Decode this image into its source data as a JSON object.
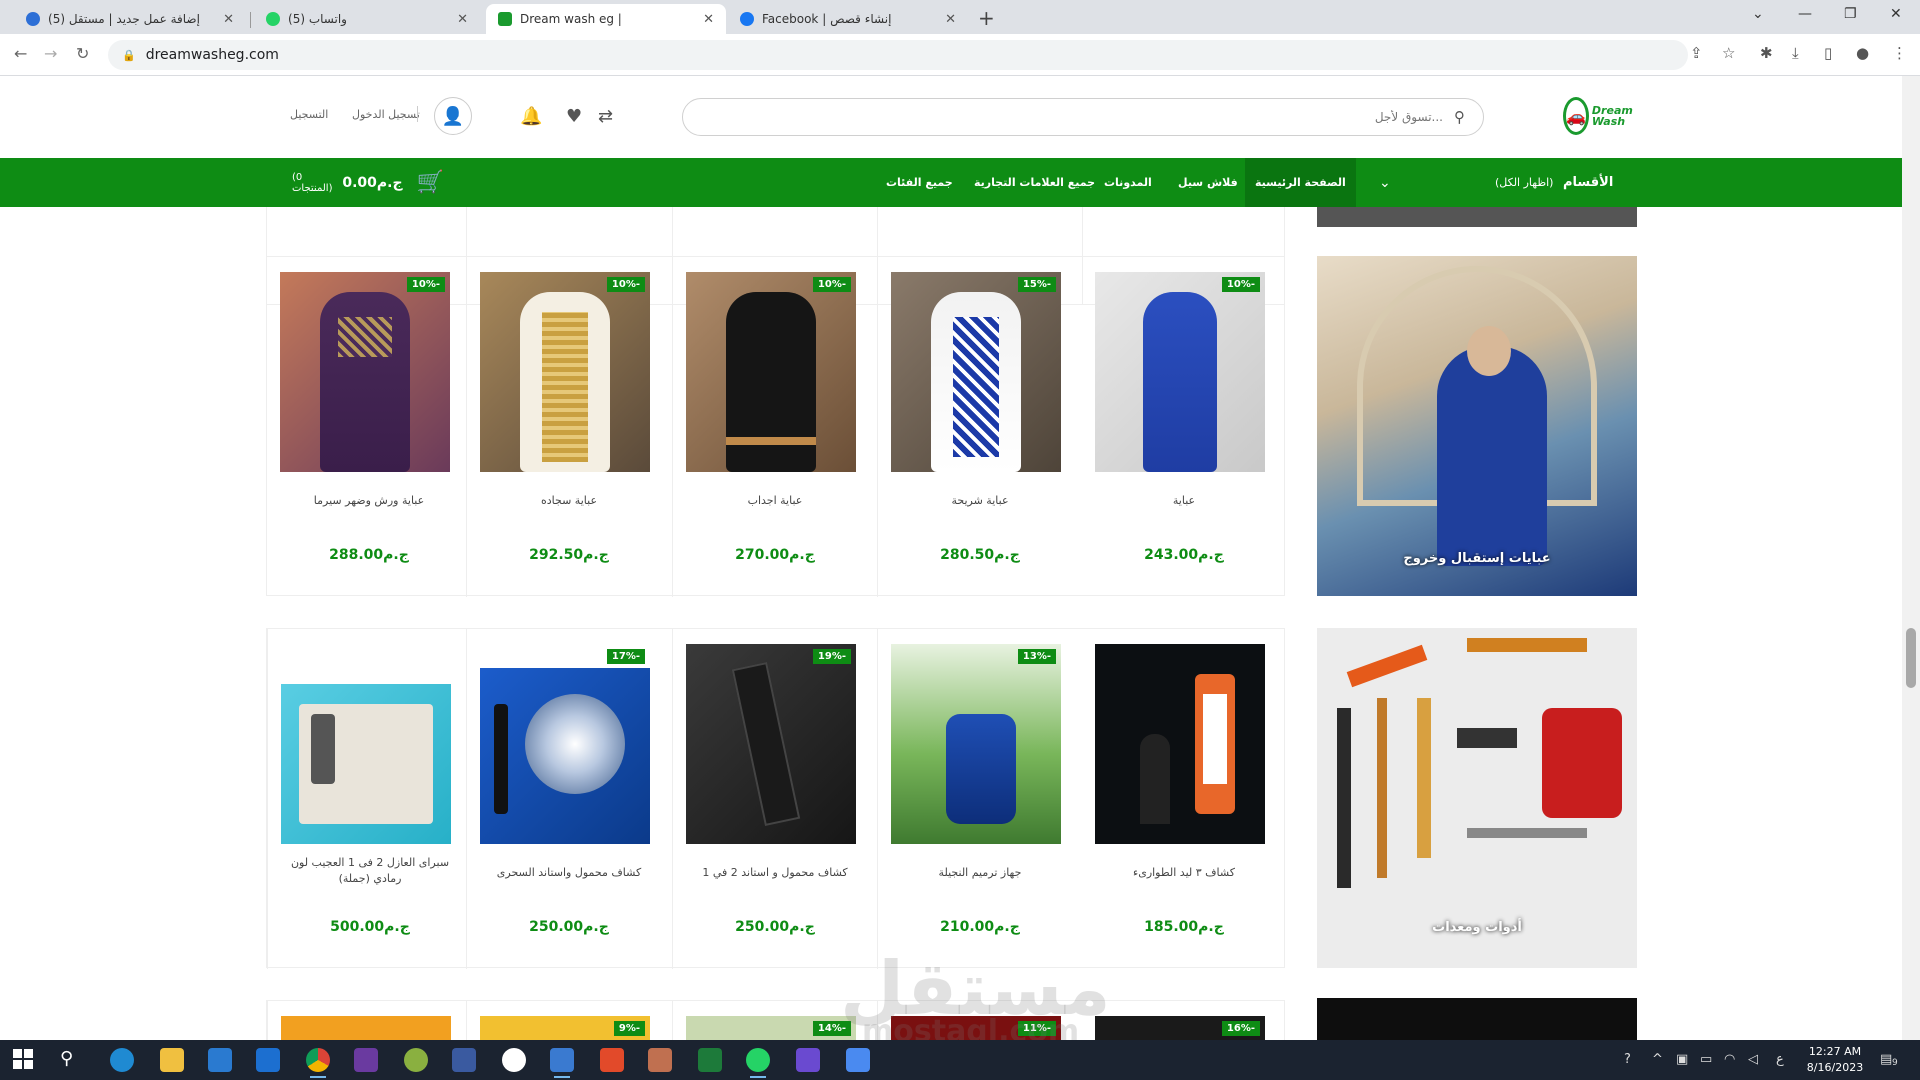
{
  "browser": {
    "tabs": [
      {
        "title": "إضافة عمل جديد | مستقل (5)",
        "favicon_color": "#2d6fd6",
        "active": false
      },
      {
        "title": "واتساب (5)",
        "favicon_color": "#25d366",
        "active": false
      },
      {
        "title": "Dream wash eg |",
        "favicon_color": "#1a9a2e",
        "active": true
      },
      {
        "title": "إنشاء قصص | Facebook",
        "favicon_color": "#1877f2",
        "active": false
      }
    ],
    "url": "dreamwasheg.com"
  },
  "header": {
    "logo_text": "Dream Wash",
    "search_placeholder": "...تسوق لأجل",
    "login_link": "تسجيل الدخول",
    "register_link": "التسجيل"
  },
  "navbar": {
    "categories_title": "الأقسام",
    "show_all": "(اظهار الكل)",
    "menu": [
      {
        "label": "الصفحة الرئيسية",
        "active": true
      },
      {
        "label": "فلاش سيل",
        "active": false
      },
      {
        "label": "المدونات",
        "active": false
      },
      {
        "label": "جميع العلامات التجارية",
        "active": false
      },
      {
        "label": "جميع الفئات",
        "active": false
      }
    ],
    "cart_amount": "0.00ج.م",
    "cart_count": "(0 المنتجات)"
  },
  "sections": [
    {
      "banner_caption": "عبايات إستقبال وخروج",
      "products": [
        {
          "name": "عباية",
          "price": "243.00ج.م",
          "discount": "10%-"
        },
        {
          "name": "عباية شريحة",
          "price": "280.50ج.م",
          "discount": "15%-"
        },
        {
          "name": "عباية اجداب",
          "price": "270.00ج.م",
          "discount": "10%-"
        },
        {
          "name": "عباية سجاده",
          "price": "292.50ج.م",
          "discount": "10%-"
        },
        {
          "name": "عباية ورش وضهر سيرما",
          "price": "288.00ج.م",
          "discount": "10%-"
        }
      ]
    },
    {
      "banner_caption": "أدوات ومعدات",
      "products": [
        {
          "name": "كشاف ٣ ليد الطوارىء",
          "price": "185.00ج.م",
          "discount": ""
        },
        {
          "name": "جهاز ترميم النجيلة",
          "price": "210.00ج.م",
          "discount": "13%-"
        },
        {
          "name": "كشاف محمول و استاند 2 في 1",
          "price": "250.00ج.م",
          "discount": "19%-"
        },
        {
          "name": "كشاف محمول واستاند السحرى",
          "price": "250.00ج.م",
          "discount": "17%-"
        },
        {
          "name": "سبراى العازل 2 فى 1 العجيب لون رمادي (جملة)",
          "price": "500.00ج.م",
          "discount": ""
        }
      ]
    },
    {
      "products": [
        {
          "discount": "16%-"
        },
        {
          "discount": "11%-"
        },
        {
          "discount": "14%-"
        },
        {
          "discount": "9%-"
        },
        {
          "discount": ""
        }
      ]
    }
  ],
  "watermark": {
    "main": "مستقل",
    "sub": "mostaql.com"
  },
  "taskbar": {
    "time": "12:27 AM",
    "date": "8/16/2023",
    "notification_count": "9",
    "lang": "ع"
  }
}
